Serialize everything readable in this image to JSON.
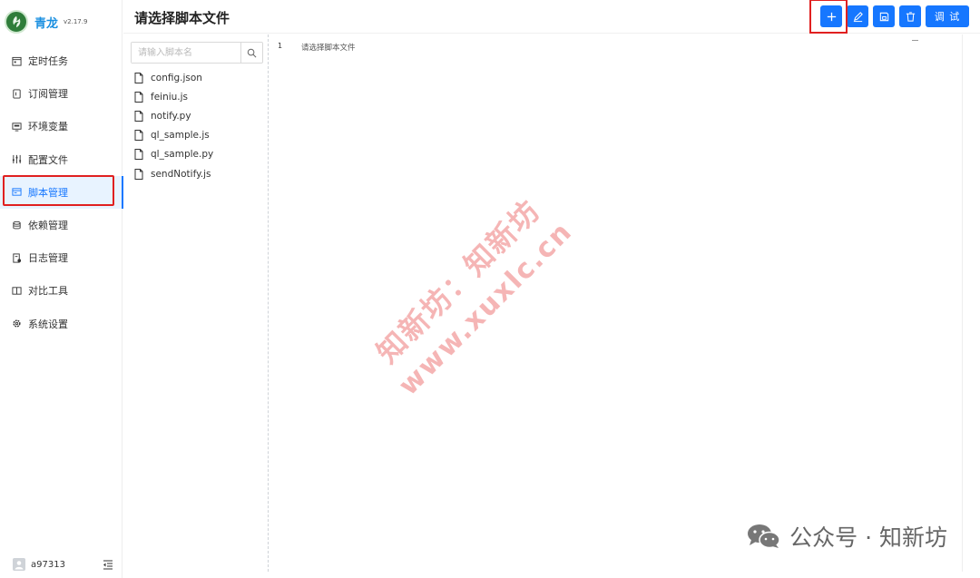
{
  "app": {
    "title": "青龙",
    "version": "v2.17.9"
  },
  "sidebar": {
    "items": [
      {
        "label": "定时任务",
        "icon": "calendar-icon",
        "active": false
      },
      {
        "label": "订阅管理",
        "icon": "subscribe-icon",
        "active": false
      },
      {
        "label": "环境变量",
        "icon": "monitor-icon",
        "active": false
      },
      {
        "label": "配置文件",
        "icon": "sliders-icon",
        "active": false
      },
      {
        "label": "脚本管理",
        "icon": "script-icon",
        "active": true
      },
      {
        "label": "依赖管理",
        "icon": "database-icon",
        "active": false
      },
      {
        "label": "日志管理",
        "icon": "log-icon",
        "active": false
      },
      {
        "label": "对比工具",
        "icon": "diff-icon",
        "active": false
      },
      {
        "label": "系统设置",
        "icon": "gear-icon",
        "active": false
      }
    ],
    "user": "a97313"
  },
  "header": {
    "title": "请选择脚本文件",
    "debug_label": "调 试"
  },
  "file_panel": {
    "search_placeholder": "请输入脚本名",
    "files": [
      "config.json",
      "feiniu.js",
      "notify.py",
      "ql_sample.js",
      "ql_sample.py",
      "sendNotify.js"
    ]
  },
  "editor": {
    "line_number": "1",
    "content": "请选择脚本文件"
  },
  "watermark": {
    "line1": "知新坊：知新坊",
    "line2": "www.xuxlc.cn"
  },
  "wechat": {
    "text": "公众号 · 知新坊"
  },
  "colors": {
    "primary": "#1677ff",
    "highlight": "#e02020"
  }
}
